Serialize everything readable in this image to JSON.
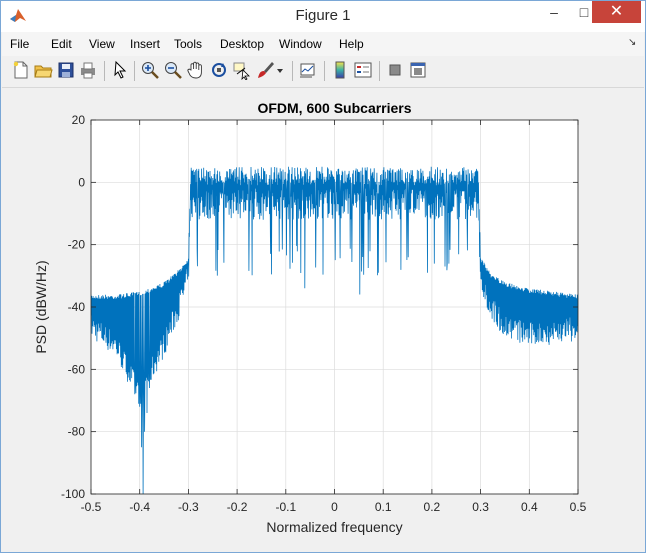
{
  "window": {
    "title": "Figure 1",
    "controls": {
      "minimize": "–",
      "maximize": "□",
      "close": "✕"
    }
  },
  "menu": {
    "items": [
      "File",
      "Edit",
      "View",
      "Insert",
      "Tools",
      "Desktop",
      "Window",
      "Help"
    ],
    "dock_glyph": "↘"
  },
  "toolbar": {
    "icons": [
      "new-figure-icon",
      "open-file-icon",
      "save-icon",
      "print-icon",
      "pointer-icon",
      "zoom-in-icon",
      "zoom-out-icon",
      "pan-icon",
      "rotate-3d-icon",
      "data-cursor-icon",
      "brush-icon",
      "brush-menu-icon",
      "link-plot-icon",
      "colorbar-icon",
      "legend-icon",
      "hide-plot-tools-icon",
      "show-plot-tools-icon"
    ]
  },
  "colors": {
    "line": "#0072bd",
    "axes_bg": "#ffffff",
    "figure_bg": "#f0f0f0",
    "grid": "#dcdcdc",
    "close_button": "#c7443a"
  },
  "chart_data": {
    "type": "line",
    "title": "OFDM, 600 Subcarriers",
    "xlabel": "Normalized frequency",
    "ylabel": "PSD (dBW/Hz)",
    "xlim": [
      -0.5,
      0.5
    ],
    "ylim": [
      -100,
      20
    ],
    "xticks": [
      -0.5,
      -0.4,
      -0.3,
      -0.2,
      -0.1,
      0,
      0.1,
      0.2,
      0.3,
      0.4,
      0.5
    ],
    "yticks": [
      -100,
      -80,
      -60,
      -40,
      -20,
      0,
      20
    ],
    "grid": true,
    "series": [
      {
        "color": "#0072bd",
        "envelope": {
          "x": [
            -0.5,
            -0.45,
            -0.4,
            -0.35,
            -0.32,
            -0.3,
            -0.295,
            -0.29,
            0.29,
            0.295,
            0.3,
            0.32,
            0.35,
            0.4,
            0.45,
            0.5
          ],
          "top": [
            -36,
            -36,
            -35,
            -32,
            -28,
            -24,
            5,
            5,
            5,
            5,
            -24,
            -29,
            -32,
            -34,
            -35,
            -36
          ],
          "bottom": [
            -50,
            -56,
            -72,
            -56,
            -44,
            -34,
            -12,
            -12,
            -12,
            -12,
            -34,
            -44,
            -50,
            -53,
            -52,
            -51
          ]
        },
        "deep_nulls": [
          [
            -0.393,
            -100
          ],
          [
            -0.396,
            -85
          ],
          [
            -0.39,
            -80
          ],
          [
            -0.385,
            -74
          ],
          [
            -0.4,
            -72
          ],
          [
            -0.41,
            -68
          ],
          [
            -0.38,
            -66
          ],
          [
            -0.061,
            -34
          ],
          [
            0.052,
            -36
          ],
          [
            0.191,
            -29
          ],
          [
            0.227,
            -27
          ],
          [
            0.09,
            -29
          ]
        ]
      }
    ]
  }
}
